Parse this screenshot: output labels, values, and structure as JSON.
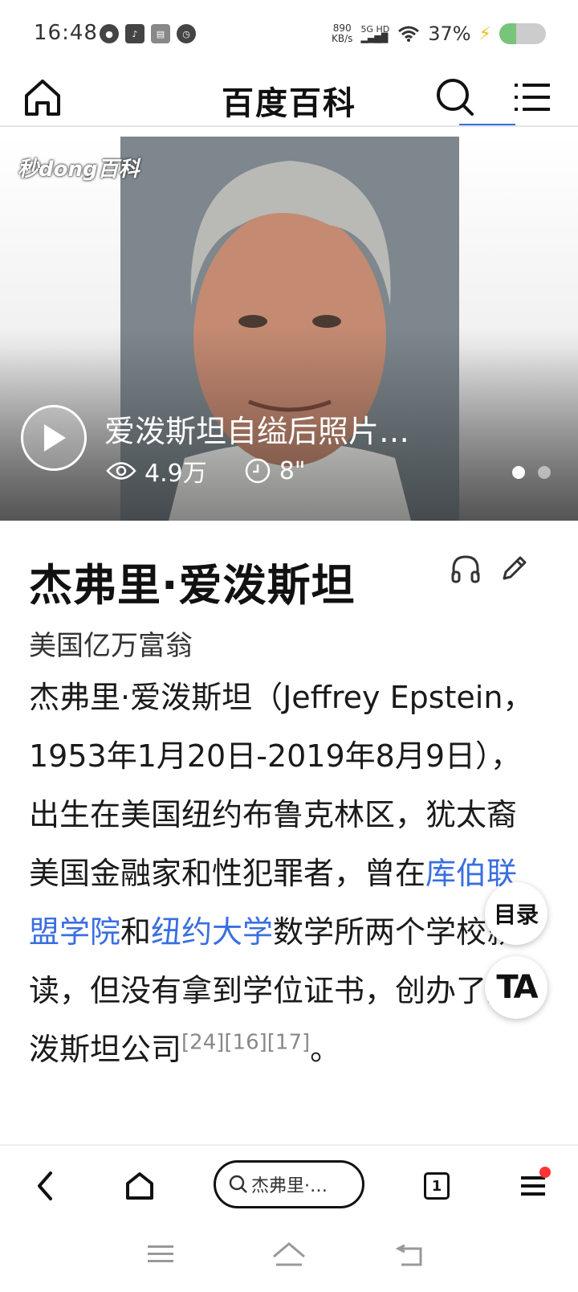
{
  "status_bar": {
    "time": "16:48",
    "speed_value": "890",
    "speed_unit": "KB/s",
    "signal": "5G HD",
    "battery_pct": "37%",
    "battery_level": 0.37,
    "icons": [
      "chat-icon",
      "tiktok-icon",
      "toutiao-icon",
      "alarm-icon",
      "wifi-icon",
      "charging-icon"
    ]
  },
  "header": {
    "title": "百度百科",
    "accent_color": "#3a6fe0"
  },
  "hero": {
    "watermark": "秒dong百科",
    "caption": "爱泼斯坦自缢后照片…",
    "views": "4.9万",
    "duration": "8\"",
    "slide_count": 2,
    "active_slide": 1
  },
  "article": {
    "title": "杰弗里·爱泼斯坦",
    "subtitle": "美国亿万富翁",
    "body_part1": "杰弗里·爱泼斯坦（Jeffrey Epstein，1953年1月20日-2019年8月9日），出生在美国纽约布鲁克林区，犹太裔美国金融家和性犯罪者，曾在",
    "link1": "库伯联盟学院",
    "body_part2": "和",
    "link2": "纽约大学",
    "body_part3": "数学所两个学校就读，但没有拿到学位证书，创办了爱泼斯坦公司",
    "refs": "[24][16][17]",
    "body_end": "。"
  },
  "floating": {
    "toc_label": "目录",
    "ta_label": "TA"
  },
  "toolbar": {
    "search_text": "杰弗里·…",
    "tab_count": "1"
  }
}
